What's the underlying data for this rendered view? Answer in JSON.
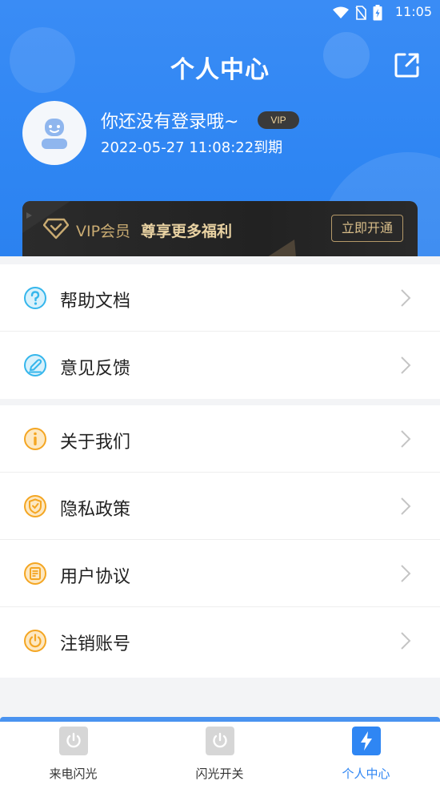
{
  "status_bar": {
    "time": "11:05"
  },
  "header": {
    "title": "个人中心"
  },
  "profile": {
    "username": "你还没有登录哦~",
    "badge": "VIP",
    "expiry": "2022-05-27 11:08:22到期"
  },
  "vip_card": {
    "title": "VIP会员",
    "subtitle": "尊享更多福利",
    "button": "立即开通"
  },
  "menu_group_1": [
    {
      "label": "帮助文档",
      "icon": "help-icon"
    },
    {
      "label": "意见反馈",
      "icon": "feedback-icon"
    }
  ],
  "menu_group_2": [
    {
      "label": "关于我们",
      "icon": "info-icon"
    },
    {
      "label": "隐私政策",
      "icon": "shield-icon"
    },
    {
      "label": "用户协议",
      "icon": "document-icon"
    },
    {
      "label": "注销账号",
      "icon": "power-icon"
    }
  ],
  "tabs": [
    {
      "label": "来电闪光",
      "icon": "power-icon",
      "active": false
    },
    {
      "label": "闪光开关",
      "icon": "power-icon",
      "active": false
    },
    {
      "label": "个人中心",
      "icon": "lightning-icon",
      "active": true
    }
  ],
  "colors": {
    "primary": "#2f86f3",
    "vip_gold": "#e9d2a2",
    "help_blue": "#35b6ec",
    "orange": "#f4a623"
  }
}
